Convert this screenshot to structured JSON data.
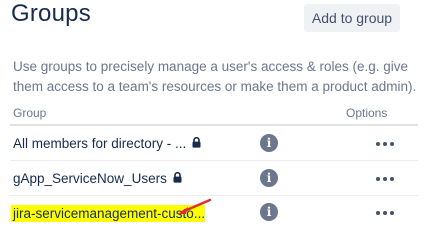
{
  "header": {
    "title": "Groups",
    "add_button_label": "Add to group"
  },
  "description": "Use groups to precisely manage a user's access & roles (e.g. give them access to a team's resources or make them a product admin).",
  "table": {
    "columns": {
      "group": "Group",
      "options": "Options"
    },
    "rows": [
      {
        "name": "All members for directory - ...",
        "locked": true,
        "highlighted": false
      },
      {
        "name": "gApp_ServiceNow_Users",
        "locked": true,
        "highlighted": false
      },
      {
        "name": "jira-servicemanagement-custo...",
        "locked": false,
        "highlighted": true
      }
    ]
  },
  "icons": {
    "info": "i",
    "more": "more-horizontal-icon",
    "lock": "lock-icon",
    "annotation": "red-arrow-icon"
  },
  "colors": {
    "highlight": "#ffff00",
    "arrow": "#e52d2d",
    "info_bg": "#6b778c"
  }
}
